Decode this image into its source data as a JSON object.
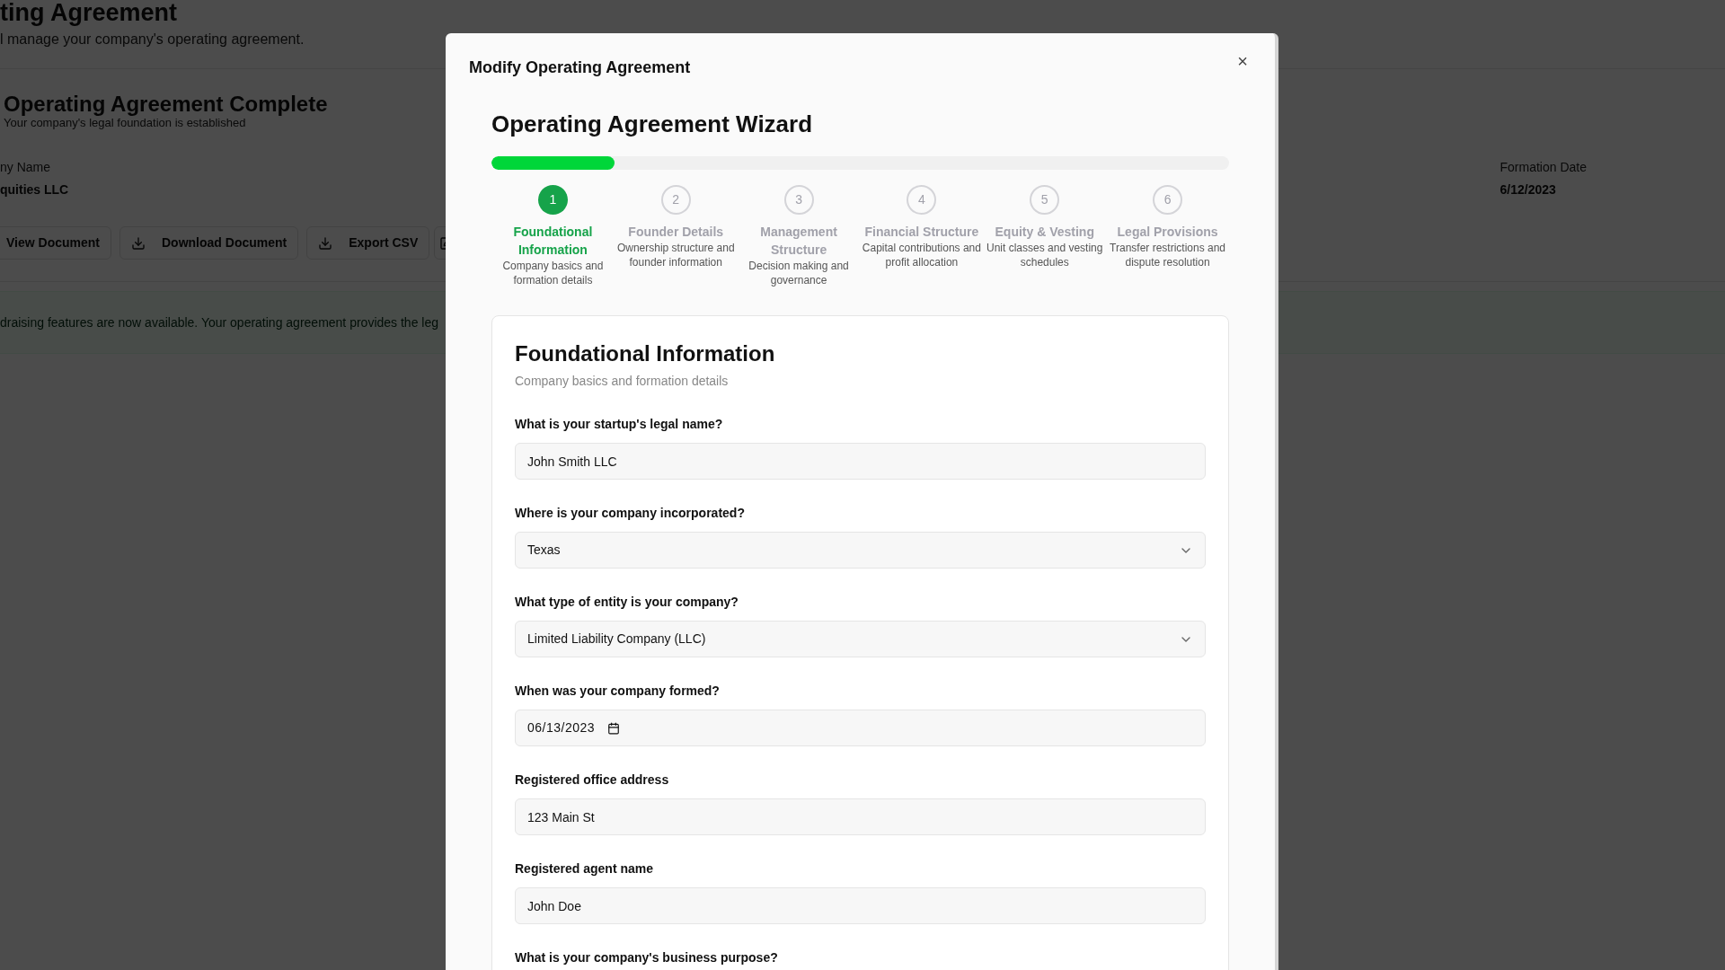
{
  "background": {
    "title": "ting Agreement",
    "subtitle": "l manage your company's operating agreement.",
    "status_title": "Operating Agreement Complete",
    "status_subtitle": "Your company's legal foundation is established",
    "details": [
      {
        "label": "ny Name",
        "value": "quities LLC"
      },
      {
        "label": "Formation Date",
        "value": "6/12/2023"
      }
    ],
    "actions": [
      {
        "label": "View Document",
        "kind": "plain"
      },
      {
        "label": "Download Document",
        "kind": "download"
      },
      {
        "label": "Export CSV",
        "kind": "download"
      }
    ],
    "banner": "draising features are now available. Your operating agreement provides the leg"
  },
  "dialog": {
    "title": "Modify Operating Agreement",
    "close": "×",
    "wizard": {
      "title": "Operating Agreement Wizard",
      "progress": {
        "level": 0.1667
      },
      "steps": [
        {
          "number": "1",
          "title": "Foundational Information",
          "description": "Company basics and formation details",
          "selected": true
        },
        {
          "number": "2",
          "title": "Founder Details",
          "description": "Ownership structure and founder information",
          "selected": false
        },
        {
          "number": "3",
          "title": "Management Structure",
          "description": "Decision making and governance",
          "selected": false
        },
        {
          "number": "4",
          "title": "Financial Structure",
          "description": "Capital contributions and profit allocation",
          "selected": false
        },
        {
          "number": "5",
          "title": "Equity & Vesting",
          "description": "Unit classes and vesting schedules",
          "selected": false
        },
        {
          "number": "6",
          "title": "Legal Provisions",
          "description": "Transfer restrictions and dispute resolution",
          "selected": false
        }
      ],
      "section": {
        "title": "Foundational Information",
        "subtitle": "Company basics and formation details",
        "fields": [
          {
            "kind": "text",
            "label": "What is your startup's legal name?",
            "value": "John Smith LLC"
          },
          {
            "kind": "select",
            "label": "Where is your company incorporated?",
            "value": "Texas"
          },
          {
            "kind": "select",
            "label": "What type of entity is your company?",
            "value": "Limited Liability Company (LLC)"
          },
          {
            "kind": "date",
            "label": "When was your company formed?",
            "value": "06/13/2023"
          },
          {
            "kind": "text",
            "label": "Registered office address",
            "value": "123 Main St"
          },
          {
            "kind": "text",
            "label": "Registered agent name",
            "value": "John Doe"
          },
          {
            "kind": "label",
            "label": "What is your company's business purpose?"
          }
        ]
      }
    }
  }
}
